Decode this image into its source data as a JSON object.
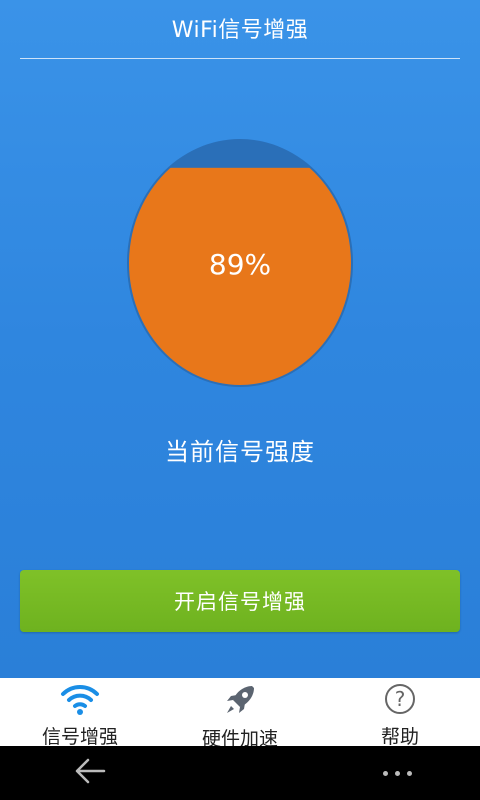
{
  "header": {
    "title": "WiFi信号增强"
  },
  "gauge": {
    "value_text": "89%",
    "fill_fraction": 0.89,
    "fill_color": "#e8771a",
    "empty_color": "#2a6fb8"
  },
  "caption": "当前信号强度",
  "boost_button": {
    "label": "开启信号增强"
  },
  "tabs": [
    {
      "label": "信号增强",
      "icon": "wifi-icon",
      "active": true
    },
    {
      "label": "硬件加速",
      "icon": "rocket-icon",
      "active": false
    },
    {
      "label": "帮助",
      "icon": "help-icon",
      "active": false
    }
  ],
  "colors": {
    "accent": "#2f86df",
    "button": "#72b622",
    "active_tab": "#1a8ee6"
  }
}
